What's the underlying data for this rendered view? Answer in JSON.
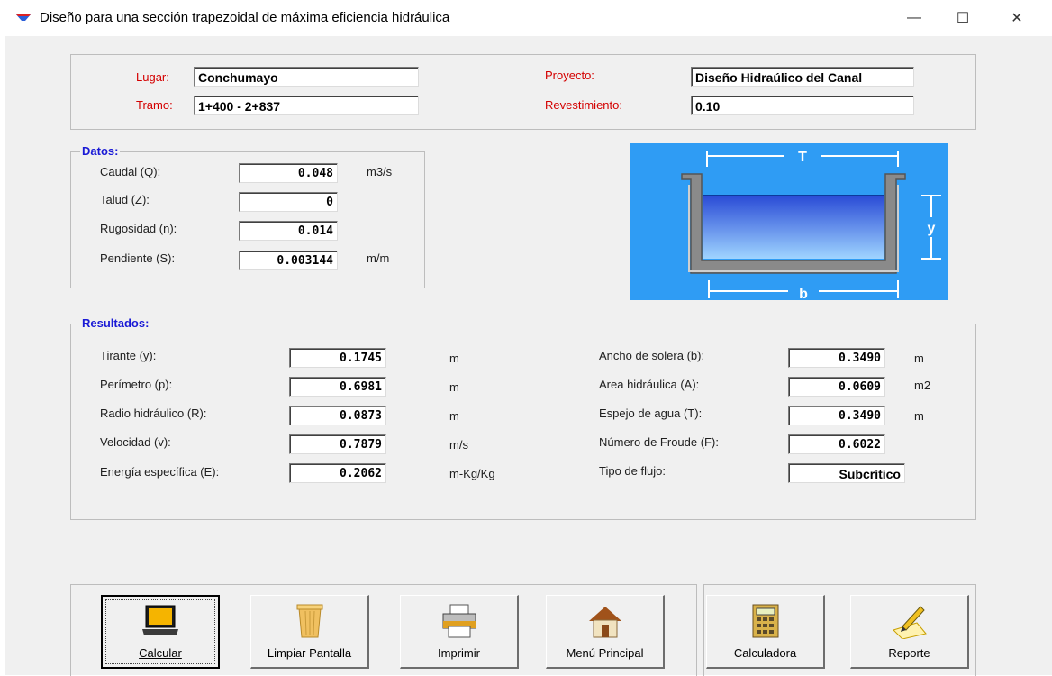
{
  "window": {
    "title": "Diseño para una sección trapezoidal de máxima eficiencia hidráulica",
    "controls": {
      "minimize": "—",
      "maximize": "☐",
      "close": "✕"
    }
  },
  "header": {
    "lugar_label": "Lugar:",
    "lugar_value": "Conchumayo",
    "tramo_label": "Tramo:",
    "tramo_value": "1+400  -  2+837",
    "proyecto_label": "Proyecto:",
    "proyecto_value": "Diseño Hidraúlico del Canal",
    "revestimiento_label": "Revestimiento:",
    "revestimiento_value": "0.10"
  },
  "datos": {
    "title": "Datos:",
    "caudal_label": "Caudal (Q):",
    "caudal_value": "0.048",
    "caudal_unit": "m3/s",
    "talud_label": "Talud (Z):",
    "talud_value": "0",
    "rugosidad_label": "Rugosidad (n):",
    "rugosidad_value": "0.014",
    "pendiente_label": "Pendiente (S):",
    "pendiente_value": "0.003144",
    "pendiente_unit": "m/m"
  },
  "diagram": {
    "T": "T",
    "y": "y",
    "b": "b"
  },
  "resultados": {
    "title": "Resultados:",
    "tirante_label": "Tirante (y):",
    "tirante_value": "0.1745",
    "tirante_unit": "m",
    "perimetro_label": "Perímetro (p):",
    "perimetro_value": "0.6981",
    "perimetro_unit": "m",
    "radio_label": "Radio hidráulico (R):",
    "radio_value": "0.0873",
    "radio_unit": "m",
    "velocidad_label": "Velocidad (v):",
    "velocidad_value": "0.7879",
    "velocidad_unit": "m/s",
    "energia_label": "Energía específica (E):",
    "energia_value": "0.2062",
    "energia_unit": "m-Kg/Kg",
    "ancho_label": "Ancho de solera (b):",
    "ancho_value": "0.3490",
    "ancho_unit": "m",
    "area_label": "Area hidráulica (A):",
    "area_value": "0.0609",
    "area_unit": "m2",
    "espejo_label": "Espejo de agua (T):",
    "espejo_value": "0.3490",
    "espejo_unit": "m",
    "froude_label": "Número de Froude (F):",
    "froude_value": "0.6022",
    "flujo_label": "Tipo de flujo:",
    "flujo_value": "Subcrítico"
  },
  "toolbar": {
    "calcular": "Calcular",
    "limpiar": "Limpiar Pantalla",
    "imprimir": "Imprimir",
    "menu": "Menú Principal",
    "calculadora": "Calculadora",
    "reporte": "Reporte"
  },
  "icons": [
    "app-icon",
    "laptop-icon",
    "trash-can-icon",
    "printer-icon",
    "house-icon",
    "calculator-icon",
    "pencil-paper-icon"
  ],
  "colors": {
    "accent_blue": "#1a1ad6",
    "label_red": "#d40000",
    "diagram_bg": "#2f9cf4"
  }
}
